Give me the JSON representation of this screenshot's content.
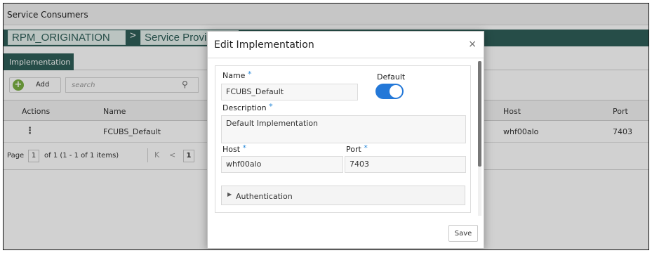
{
  "app": {
    "title": "Service Consumers"
  },
  "breadcrumb": {
    "root": "RPM_ORIGINATION",
    "separator": ">",
    "current": "Service Provid"
  },
  "tabs": {
    "active_label": "Implementation"
  },
  "toolbar": {
    "add_label": "Add",
    "search_placeholder": "search"
  },
  "grid": {
    "headers": {
      "actions": "Actions",
      "name": "Name",
      "host": "Host",
      "port": "Port"
    },
    "rows": [
      {
        "actions": "⋮",
        "name": "FCUBS_Default",
        "host": "whf00alo",
        "port": "7403"
      }
    ]
  },
  "pager": {
    "page_label": "Page",
    "page_value": "1",
    "of_text": "of 1  (1 - 1 of 1 items)",
    "first_icon": "K",
    "prev_icon": "<",
    "current_page_box": "1"
  },
  "modal": {
    "title": "Edit Implementation",
    "close": "×",
    "name_label": "Name",
    "name_value": "FCUBS_Default",
    "default_label": "Default",
    "default_on": true,
    "description_label": "Description",
    "description_value": "Default Implementation",
    "host_label": "Host",
    "host_value": "whf00alo",
    "port_label": "Port",
    "port_value": "7403",
    "required_mark": "*",
    "authentication_label": "Authentication",
    "save_label": "Save"
  },
  "colors": {
    "header_teal": "#2f5f58",
    "toggle_blue": "#2478d8",
    "add_green": "#7bb043",
    "required_blue": "#2b8ad9"
  }
}
